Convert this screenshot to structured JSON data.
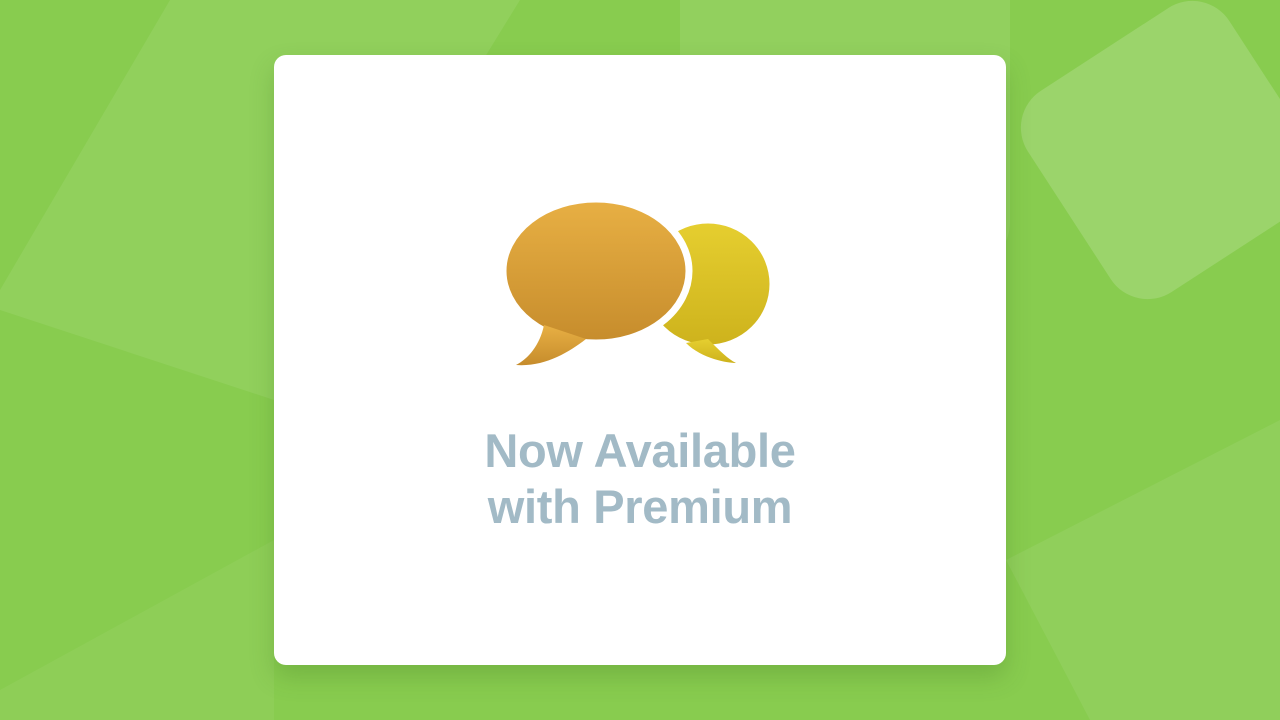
{
  "background": {
    "color": "#88cc4f",
    "shape_color": "#a4dc73"
  },
  "card": {
    "icon": "speech-bubbles-icon",
    "icon_colors": {
      "front_bubble_top": "#e8b044",
      "front_bubble_bottom": "#c68c2c",
      "back_bubble_top": "#e6cf30",
      "back_bubble_bottom": "#cdb21c"
    },
    "headline_line1": "Now Available",
    "headline_line2": "with Premium",
    "text_color": "#a2bac6"
  }
}
